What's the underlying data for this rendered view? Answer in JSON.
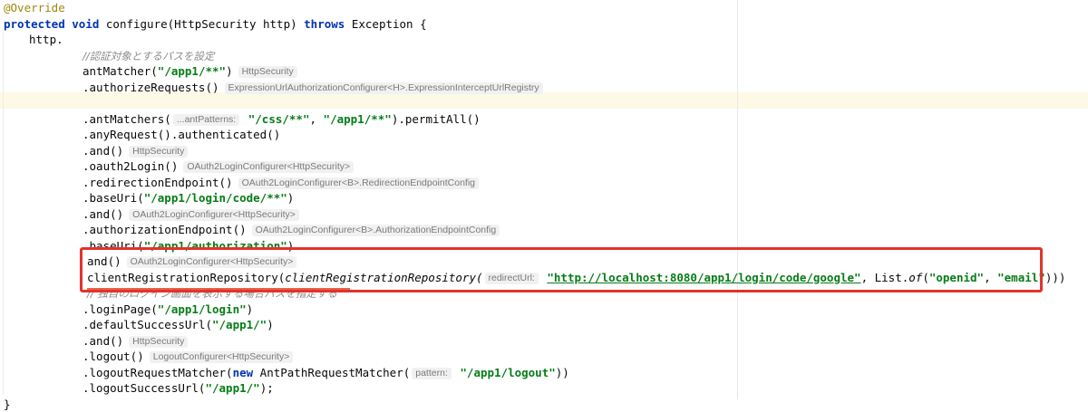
{
  "editor": {
    "lines": [
      {
        "id": "l0",
        "indent": 4,
        "segments": [
          {
            "t": "@Override",
            "c": "ann"
          }
        ]
      },
      {
        "id": "l1",
        "indent": 4,
        "segments": [
          {
            "t": "protected",
            "c": "kw"
          },
          {
            "t": " "
          },
          {
            "t": "void",
            "c": "kw"
          },
          {
            "t": " configure(HttpSecurity http) "
          },
          {
            "t": "throws",
            "c": "kw"
          },
          {
            "t": " Exception {"
          }
        ]
      },
      {
        "id": "l2",
        "indent": 32,
        "segments": [
          {
            "t": "http."
          }
        ]
      },
      {
        "id": "l3",
        "indent": 91,
        "segments": [
          {
            "t": "//認証対象とするパスを設定",
            "c": "cmt"
          }
        ]
      },
      {
        "id": "l4",
        "indent": 91,
        "segments": [
          {
            "t": "antMatcher("
          },
          {
            "t": "\"/app1/**\"",
            "c": "str"
          },
          {
            "t": ")"
          },
          {
            "t": "HttpSecurity",
            "c": "hint chip"
          }
        ]
      },
      {
        "id": "l5",
        "indent": 91,
        "segments": [
          {
            "t": ".authorizeRequests()"
          },
          {
            "t": "ExpressionUrlAuthorizationConfigurer<H>.ExpressionInterceptUrlRegistry",
            "c": "hint chip"
          }
        ]
      },
      {
        "id": "l6",
        "indent": 91,
        "segments": []
      },
      {
        "id": "l7",
        "indent": 91,
        "segments": [
          {
            "t": ".antMatchers("
          },
          {
            "t": "...antPatterns:",
            "c": "hint"
          },
          {
            "t": " "
          },
          {
            "t": "\"/css/**\"",
            "c": "str"
          },
          {
            "t": ", "
          },
          {
            "t": "\"/app1/**\"",
            "c": "str"
          },
          {
            "t": ").permitAll()"
          }
        ]
      },
      {
        "id": "l8",
        "indent": 91,
        "segments": [
          {
            "t": ".anyRequest().authenticated()"
          }
        ]
      },
      {
        "id": "l9",
        "indent": 91,
        "segments": [
          {
            "t": ".and()"
          },
          {
            "t": "HttpSecurity",
            "c": "hint chip"
          }
        ]
      },
      {
        "id": "l10",
        "indent": 91,
        "segments": [
          {
            "t": ".oauth2Login()"
          },
          {
            "t": "OAuth2LoginConfigurer<HttpSecurity>",
            "c": "hint chip"
          }
        ]
      },
      {
        "id": "l11",
        "indent": 91,
        "segments": [
          {
            "t": ".redirectionEndpoint()"
          },
          {
            "t": "OAuth2LoginConfigurer<B>.RedirectionEndpointConfig",
            "c": "hint chip"
          }
        ]
      },
      {
        "id": "l12",
        "indent": 91,
        "segments": [
          {
            "t": ".baseUri("
          },
          {
            "t": "\"/app1/login/code/**\"",
            "c": "str"
          },
          {
            "t": ")"
          }
        ]
      },
      {
        "id": "l13",
        "indent": 91,
        "segments": [
          {
            "t": ".and()"
          },
          {
            "t": "OAuth2LoginConfigurer<HttpSecurity>",
            "c": "hint chip"
          }
        ]
      },
      {
        "id": "l14",
        "indent": 91,
        "segments": [
          {
            "t": ".authorizationEndpoint()"
          },
          {
            "t": "OAuth2LoginConfigurer<B>.AuthorizationEndpointConfig",
            "c": "hint chip"
          }
        ]
      },
      {
        "id": "l15",
        "indent": 91,
        "segments": [
          {
            "t": ".baseUri("
          },
          {
            "t": "\"/app1/authorization\"",
            "c": "str"
          },
          {
            "t": ")"
          }
        ]
      },
      {
        "id": "l16",
        "indent": 96,
        "segments": [
          {
            "t": "and()"
          },
          {
            "t": "OAuth2LoginConfigurer<HttpSecurity>",
            "c": "hint chip"
          }
        ]
      },
      {
        "id": "l17",
        "indent": 96,
        "segments": [
          {
            "t": "clientRegistrationRepository("
          },
          {
            "t": "clientRegistrationRepository(",
            "c": "ital"
          },
          {
            "t": "redirectUrl:",
            "c": "hint"
          },
          {
            "t": " "
          },
          {
            "t": "\"http://localhost:8080/app1/login/code/google\"",
            "c": "str ul"
          },
          {
            "t": ", List."
          },
          {
            "t": "of",
            "c": "ital"
          },
          {
            "t": "("
          },
          {
            "t": "\"openid\"",
            "c": "str"
          },
          {
            "t": ", "
          },
          {
            "t": "\"email\"",
            "c": "str"
          },
          {
            "t": ")))"
          }
        ]
      },
      {
        "id": "l18",
        "indent": 96,
        "segments": [
          {
            "t": "// 独自のログイン画面を表示する場合パスを指定する",
            "c": "cmt"
          }
        ]
      },
      {
        "id": "l19",
        "indent": 91,
        "segments": [
          {
            "t": ".loginPage("
          },
          {
            "t": "\"/app1/login\"",
            "c": "str"
          },
          {
            "t": ")"
          }
        ]
      },
      {
        "id": "l20",
        "indent": 91,
        "segments": [
          {
            "t": ".defaultSuccessUrl("
          },
          {
            "t": "\"/app1/\"",
            "c": "str"
          },
          {
            "t": ")"
          }
        ]
      },
      {
        "id": "l21",
        "indent": 91,
        "segments": [
          {
            "t": ".and()"
          },
          {
            "t": "HttpSecurity",
            "c": "hint chip"
          }
        ]
      },
      {
        "id": "l22",
        "indent": 91,
        "segments": [
          {
            "t": ".logout()"
          },
          {
            "t": "LogoutConfigurer<HttpSecurity>",
            "c": "hint chip"
          }
        ]
      },
      {
        "id": "l23",
        "indent": 91,
        "segments": [
          {
            "t": ".logoutRequestMatcher("
          },
          {
            "t": "new",
            "c": "kw"
          },
          {
            "t": " AntPathRequestMatcher("
          },
          {
            "t": "pattern:",
            "c": "hint"
          },
          {
            "t": " "
          },
          {
            "t": "\"/app1/logout\"",
            "c": "str"
          },
          {
            "t": "))"
          }
        ]
      },
      {
        "id": "l24",
        "indent": 91,
        "segments": [
          {
            "t": ".logoutSuccessUrl("
          },
          {
            "t": "\"/app1/\"",
            "c": "str"
          },
          {
            "t": ");"
          }
        ]
      },
      {
        "id": "l25",
        "indent": 4,
        "segments": [
          {
            "t": "}"
          }
        ]
      }
    ]
  },
  "colors": {
    "keyword": "#0033b3",
    "annotation": "#9e880d",
    "string": "#067d17",
    "comment": "#8c8c8c",
    "highlight_box": "#e3332b",
    "current_line": "#fcf9e6"
  }
}
